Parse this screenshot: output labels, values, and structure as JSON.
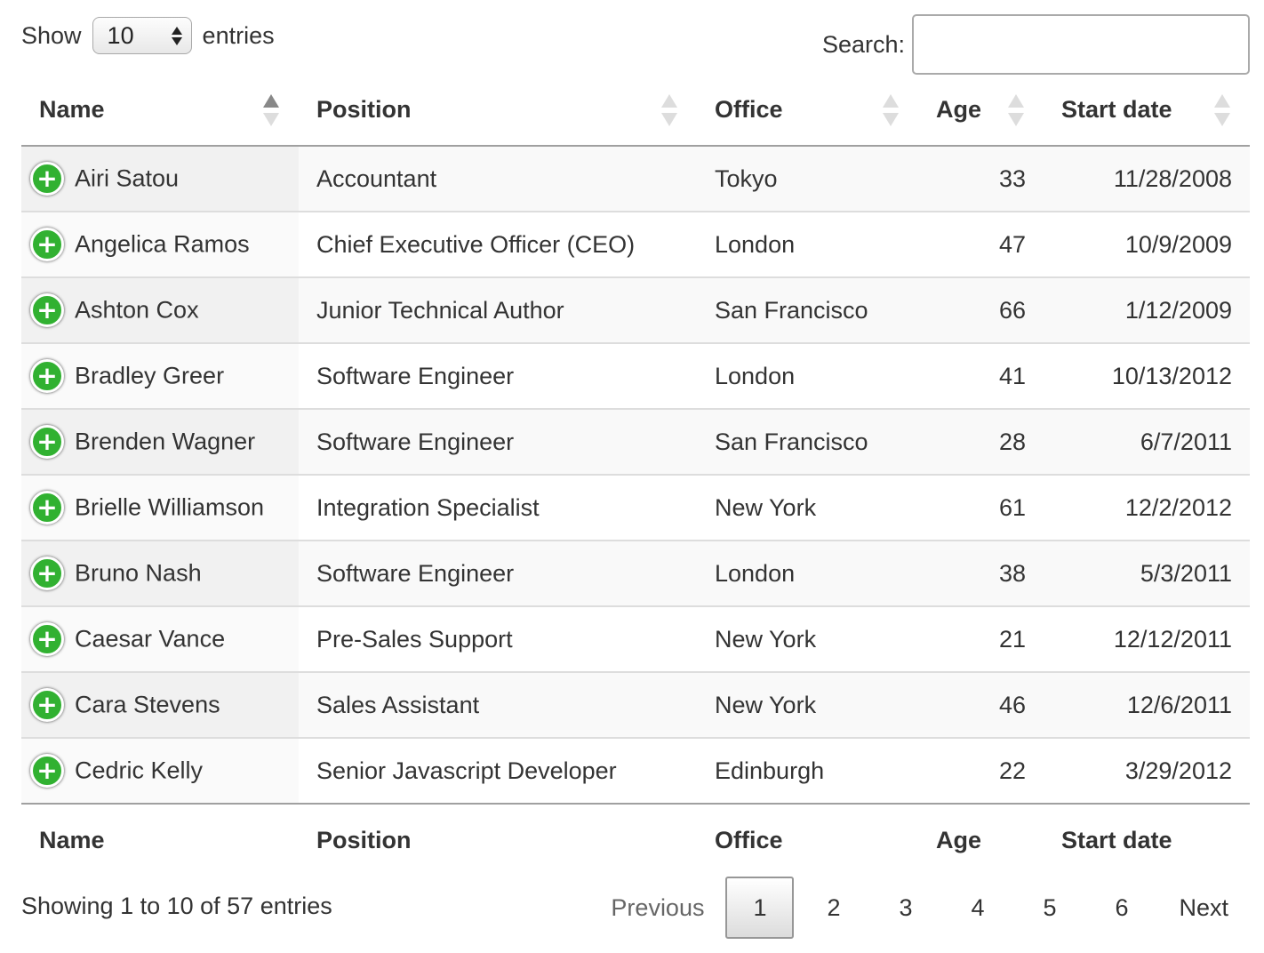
{
  "length": {
    "show_label": "Show",
    "selected": "10",
    "entries_label": "entries"
  },
  "search": {
    "label": "Search:",
    "value": "",
    "placeholder": ""
  },
  "columns": [
    "Name",
    "Position",
    "Office",
    "Age",
    "Start date"
  ],
  "rows": [
    {
      "name": "Airi Satou",
      "position": "Accountant",
      "office": "Tokyo",
      "age": "33",
      "start": "11/28/2008"
    },
    {
      "name": "Angelica Ramos",
      "position": "Chief Executive Officer (CEO)",
      "office": "London",
      "age": "47",
      "start": "10/9/2009"
    },
    {
      "name": "Ashton Cox",
      "position": "Junior Technical Author",
      "office": "San Francisco",
      "age": "66",
      "start": "1/12/2009"
    },
    {
      "name": "Bradley Greer",
      "position": "Software Engineer",
      "office": "London",
      "age": "41",
      "start": "10/13/2012"
    },
    {
      "name": "Brenden Wagner",
      "position": "Software Engineer",
      "office": "San Francisco",
      "age": "28",
      "start": "6/7/2011"
    },
    {
      "name": "Brielle Williamson",
      "position": "Integration Specialist",
      "office": "New York",
      "age": "61",
      "start": "12/2/2012"
    },
    {
      "name": "Bruno Nash",
      "position": "Software Engineer",
      "office": "London",
      "age": "38",
      "start": "5/3/2011"
    },
    {
      "name": "Caesar Vance",
      "position": "Pre-Sales Support",
      "office": "New York",
      "age": "21",
      "start": "12/12/2011"
    },
    {
      "name": "Cara Stevens",
      "position": "Sales Assistant",
      "office": "New York",
      "age": "46",
      "start": "12/6/2011"
    },
    {
      "name": "Cedric Kelly",
      "position": "Senior Javascript Developer",
      "office": "Edinburgh",
      "age": "22",
      "start": "3/29/2012"
    }
  ],
  "info": "Showing 1 to 10 of 57 entries",
  "pagination": {
    "previous": "Previous",
    "pages": [
      "1",
      "2",
      "3",
      "4",
      "5",
      "6"
    ],
    "current": "1",
    "next": "Next"
  },
  "colors": {
    "expand_icon": "#31b131",
    "odd_row": "#f9f9f9",
    "sorted_column": "#f1f1f1"
  },
  "icons": {
    "expand": "plus-circle-icon",
    "sort": "sort-arrows-icon"
  }
}
